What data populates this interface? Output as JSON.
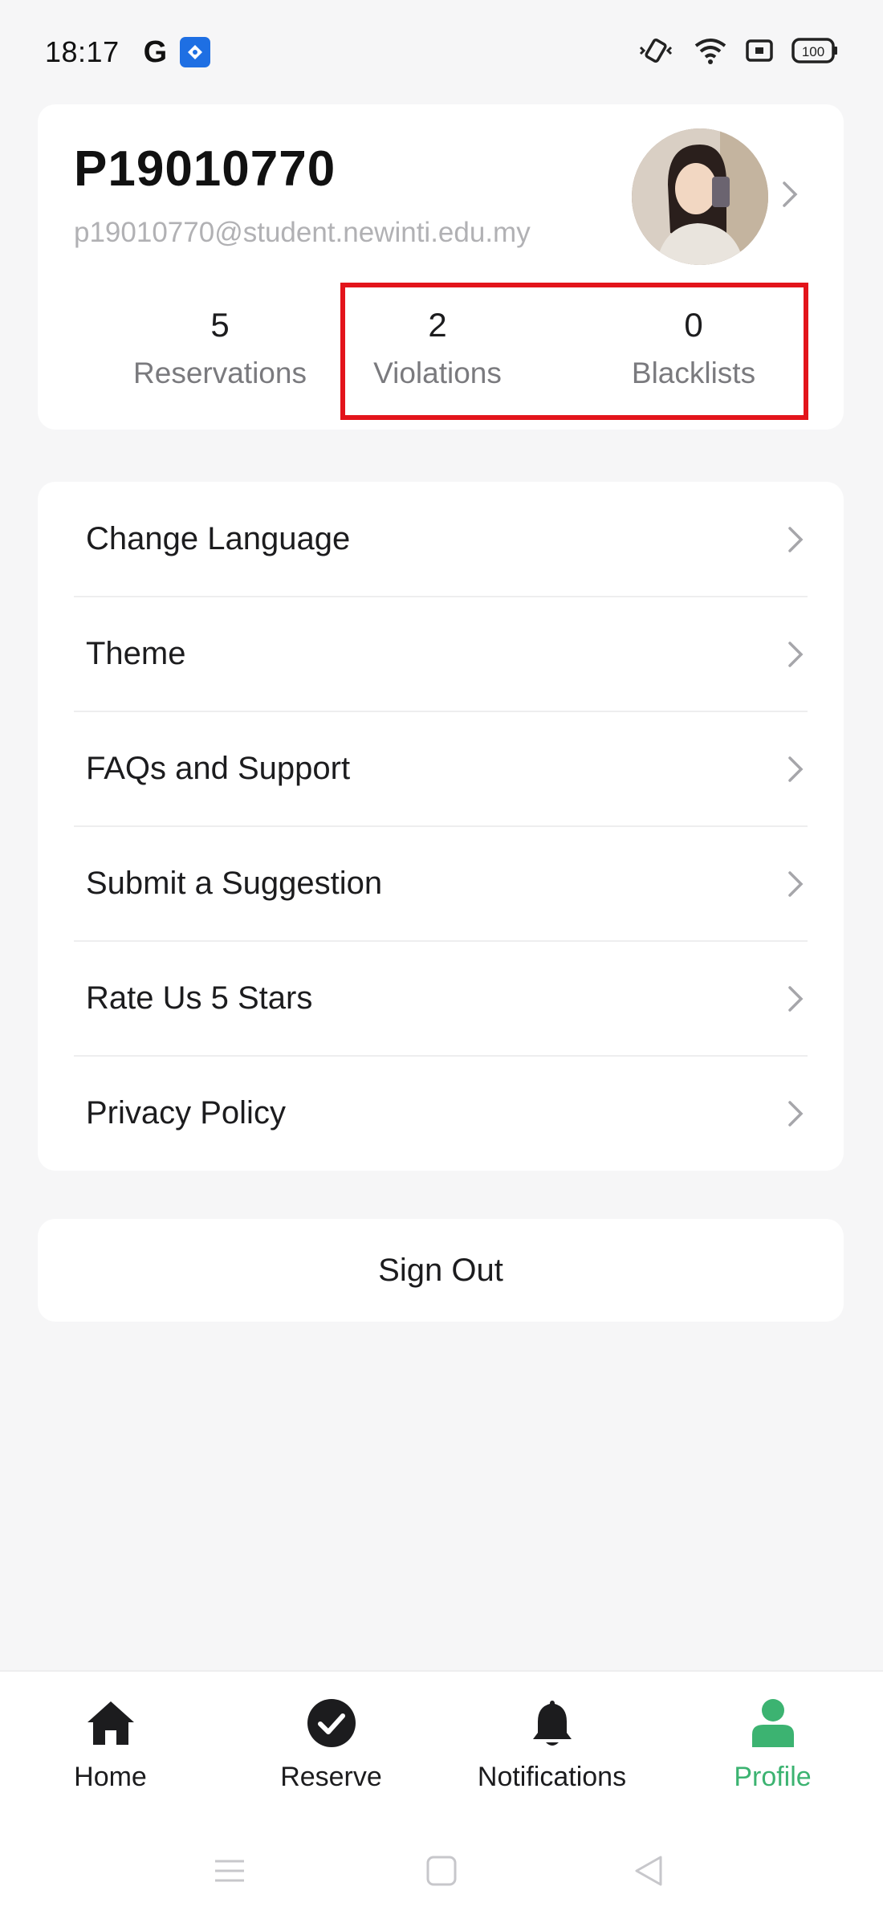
{
  "status_bar": {
    "time": "18:17",
    "google_icon": "G",
    "icons": [
      "app-icon",
      "vibrate-icon",
      "wifi-icon",
      "cast-icon",
      "battery-icon"
    ],
    "battery": "100"
  },
  "profile": {
    "user_id": "P19010770",
    "email": "p19010770@student.newinti.edu.my",
    "stats": [
      {
        "value": "5",
        "label": "Reservations"
      },
      {
        "value": "2",
        "label": "Violations"
      },
      {
        "value": "0",
        "label": "Blacklists"
      }
    ]
  },
  "menu": {
    "items": [
      {
        "label": "Change Language"
      },
      {
        "label": "Theme"
      },
      {
        "label": "FAQs and Support"
      },
      {
        "label": "Submit a Suggestion"
      },
      {
        "label": "Rate Us 5 Stars"
      },
      {
        "label": "Privacy Policy"
      }
    ]
  },
  "sign_out": {
    "label": "Sign Out"
  },
  "bottom_nav": {
    "items": [
      {
        "label": "Home",
        "icon": "home-icon"
      },
      {
        "label": "Reserve",
        "icon": "check-circle-icon"
      },
      {
        "label": "Notifications",
        "icon": "bell-icon"
      },
      {
        "label": "Profile",
        "icon": "person-icon",
        "active": true
      }
    ]
  },
  "colors": {
    "accent": "#3cb371",
    "highlight": "#e3141b",
    "background": "#f6f6f7"
  }
}
